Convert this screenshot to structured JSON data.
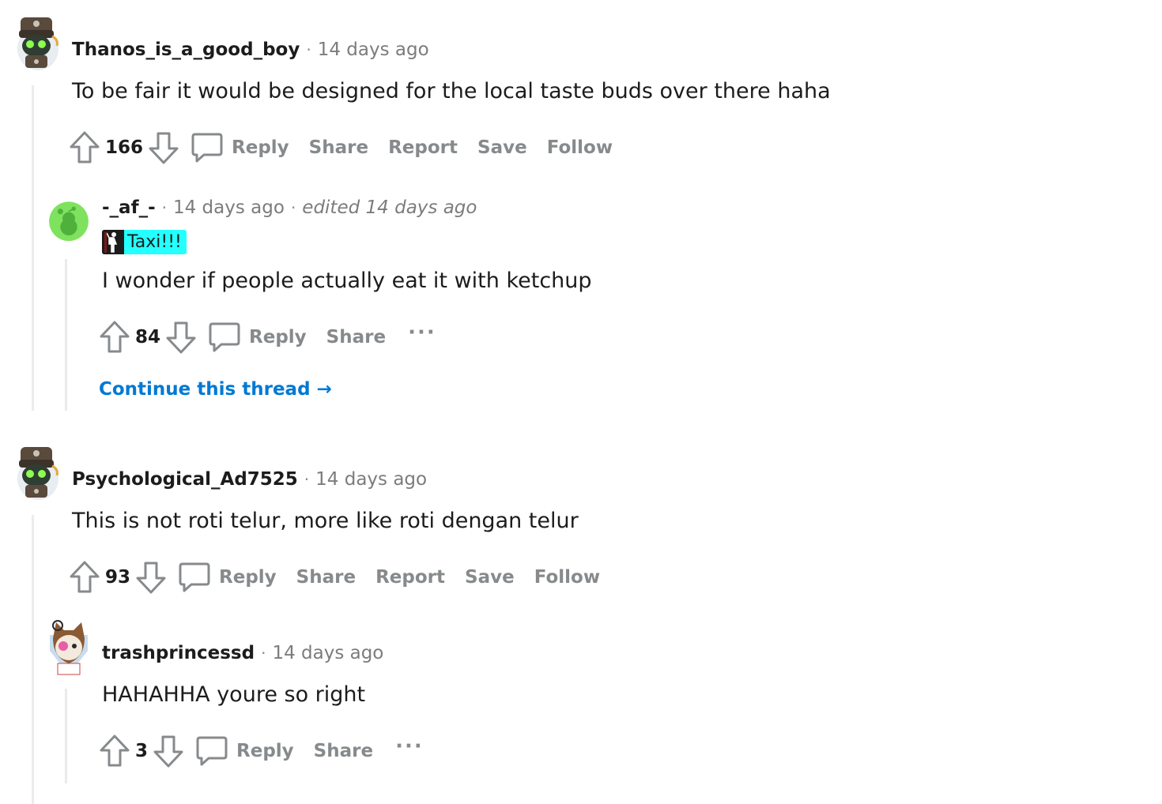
{
  "colors": {
    "thread_line": "#ebebeb",
    "meta_grey": "#7c7c7c",
    "action_grey": "#878a8c",
    "link_blue": "#0079d3",
    "flair_bg": "#24ffff",
    "avatar_green": "#7ee25e"
  },
  "comments": [
    {
      "username": "Thanos_is_a_good_boy",
      "time": "14 days ago",
      "body": "To be fair it would be designed for the local taste buds over there haha",
      "score": "166",
      "actions": {
        "reply": "Reply",
        "share": "Share",
        "report": "Report",
        "save": "Save",
        "follow": "Follow"
      },
      "avatar_icon": "robot-avatar-icon"
    },
    {
      "username": "-_af_-",
      "time": "14 days ago",
      "edited": "edited 14 days ago",
      "flair": "Taxi!!!",
      "body": "I wonder if people actually eat it with ketchup",
      "score": "84",
      "actions": {
        "reply": "Reply",
        "share": "Share",
        "more": "···"
      },
      "continue": "Continue this thread",
      "avatar_icon": "default-snoo-avatar-icon"
    },
    {
      "username": "Psychological_Ad7525",
      "time": "14 days ago",
      "body": "This is not roti telur, more like roti dengan telur",
      "score": "93",
      "actions": {
        "reply": "Reply",
        "share": "Share",
        "report": "Report",
        "save": "Save",
        "follow": "Follow"
      },
      "avatar_icon": "robot-avatar-icon"
    },
    {
      "username": "trashprincessd",
      "time": "14 days ago",
      "body": "HAHAHHA youre so right",
      "score": "3",
      "actions": {
        "reply": "Reply",
        "share": "Share",
        "more": "···"
      },
      "avatar_icon": "cat-avatar-icon"
    }
  ]
}
